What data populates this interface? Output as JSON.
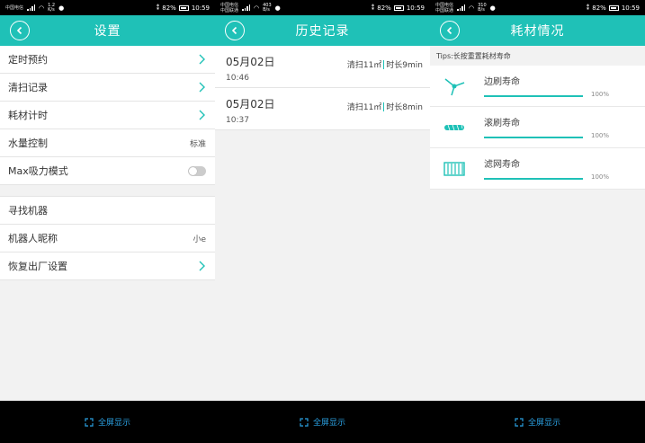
{
  "accent": "#1fc1b7",
  "status_bars": [
    {
      "carrier1": "中国电信",
      "carrier2": "",
      "speed1": "1.2",
      "speed2": "K/s",
      "battery": "82%",
      "time": "10:59"
    },
    {
      "carrier1": "中国电信",
      "carrier2": "中国联通",
      "speed1": "403",
      "speed2": "B/s",
      "battery": "82%",
      "time": "10:59"
    },
    {
      "carrier1": "中国电信",
      "carrier2": "中国联通",
      "speed1": "310",
      "speed2": "B/s",
      "battery": "82%",
      "time": "10:59"
    }
  ],
  "settings": {
    "title": "设置",
    "rows": [
      {
        "label": "定时预约",
        "value": ""
      },
      {
        "label": "清扫记录",
        "value": ""
      },
      {
        "label": "耗材计时",
        "value": ""
      },
      {
        "label": "水量控制",
        "value": "标准"
      },
      {
        "label": "Max吸力模式",
        "value": ""
      },
      {
        "label": "寻找机器",
        "value": ""
      },
      {
        "label": "机器人昵称",
        "value": "小e"
      },
      {
        "label": "恢复出厂设置",
        "value": ""
      }
    ]
  },
  "history": {
    "title": "历史记录",
    "items": [
      {
        "date": "05月02日",
        "time": "10:46",
        "area": "清扫11㎡",
        "duration": "时长9min"
      },
      {
        "date": "05月02日",
        "time": "10:37",
        "area": "清扫11㎡",
        "duration": "时长8min"
      }
    ]
  },
  "consumables": {
    "title": "耗材情况",
    "tips": "Tips:长按重置耗材寿命",
    "items": [
      {
        "name": "边刷寿命",
        "percent": 100,
        "percent_label": "100%",
        "icon": "side-brush-icon"
      },
      {
        "name": "滚刷寿命",
        "percent": 100,
        "percent_label": "100%",
        "icon": "roller-brush-icon"
      },
      {
        "name": "滤网寿命",
        "percent": 100,
        "percent_label": "100%",
        "icon": "filter-icon"
      }
    ]
  },
  "fullscreen_label": "全屏显示"
}
